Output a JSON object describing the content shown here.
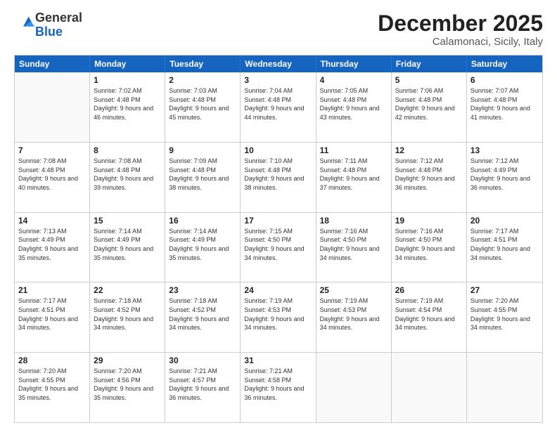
{
  "header": {
    "logo_general": "General",
    "logo_blue": "Blue",
    "month": "December 2025",
    "location": "Calamonaci, Sicily, Italy"
  },
  "days_of_week": [
    "Sunday",
    "Monday",
    "Tuesday",
    "Wednesday",
    "Thursday",
    "Friday",
    "Saturday"
  ],
  "weeks": [
    [
      {
        "day": "",
        "empty": true
      },
      {
        "day": "1",
        "sunrise": "Sunrise: 7:02 AM",
        "sunset": "Sunset: 4:48 PM",
        "daylight": "Daylight: 9 hours and 46 minutes."
      },
      {
        "day": "2",
        "sunrise": "Sunrise: 7:03 AM",
        "sunset": "Sunset: 4:48 PM",
        "daylight": "Daylight: 9 hours and 45 minutes."
      },
      {
        "day": "3",
        "sunrise": "Sunrise: 7:04 AM",
        "sunset": "Sunset: 4:48 PM",
        "daylight": "Daylight: 9 hours and 44 minutes."
      },
      {
        "day": "4",
        "sunrise": "Sunrise: 7:05 AM",
        "sunset": "Sunset: 4:48 PM",
        "daylight": "Daylight: 9 hours and 43 minutes."
      },
      {
        "day": "5",
        "sunrise": "Sunrise: 7:06 AM",
        "sunset": "Sunset: 4:48 PM",
        "daylight": "Daylight: 9 hours and 42 minutes."
      },
      {
        "day": "6",
        "sunrise": "Sunrise: 7:07 AM",
        "sunset": "Sunset: 4:48 PM",
        "daylight": "Daylight: 9 hours and 41 minutes."
      }
    ],
    [
      {
        "day": "7",
        "sunrise": "Sunrise: 7:08 AM",
        "sunset": "Sunset: 4:48 PM",
        "daylight": "Daylight: 9 hours and 40 minutes."
      },
      {
        "day": "8",
        "sunrise": "Sunrise: 7:08 AM",
        "sunset": "Sunset: 4:48 PM",
        "daylight": "Daylight: 9 hours and 39 minutes."
      },
      {
        "day": "9",
        "sunrise": "Sunrise: 7:09 AM",
        "sunset": "Sunset: 4:48 PM",
        "daylight": "Daylight: 9 hours and 38 minutes."
      },
      {
        "day": "10",
        "sunrise": "Sunrise: 7:10 AM",
        "sunset": "Sunset: 4:48 PM",
        "daylight": "Daylight: 9 hours and 38 minutes."
      },
      {
        "day": "11",
        "sunrise": "Sunrise: 7:11 AM",
        "sunset": "Sunset: 4:48 PM",
        "daylight": "Daylight: 9 hours and 37 minutes."
      },
      {
        "day": "12",
        "sunrise": "Sunrise: 7:12 AM",
        "sunset": "Sunset: 4:48 PM",
        "daylight": "Daylight: 9 hours and 36 minutes."
      },
      {
        "day": "13",
        "sunrise": "Sunrise: 7:12 AM",
        "sunset": "Sunset: 4:49 PM",
        "daylight": "Daylight: 9 hours and 36 minutes."
      }
    ],
    [
      {
        "day": "14",
        "sunrise": "Sunrise: 7:13 AM",
        "sunset": "Sunset: 4:49 PM",
        "daylight": "Daylight: 9 hours and 35 minutes."
      },
      {
        "day": "15",
        "sunrise": "Sunrise: 7:14 AM",
        "sunset": "Sunset: 4:49 PM",
        "daylight": "Daylight: 9 hours and 35 minutes."
      },
      {
        "day": "16",
        "sunrise": "Sunrise: 7:14 AM",
        "sunset": "Sunset: 4:49 PM",
        "daylight": "Daylight: 9 hours and 35 minutes."
      },
      {
        "day": "17",
        "sunrise": "Sunrise: 7:15 AM",
        "sunset": "Sunset: 4:50 PM",
        "daylight": "Daylight: 9 hours and 34 minutes."
      },
      {
        "day": "18",
        "sunrise": "Sunrise: 7:16 AM",
        "sunset": "Sunset: 4:50 PM",
        "daylight": "Daylight: 9 hours and 34 minutes."
      },
      {
        "day": "19",
        "sunrise": "Sunrise: 7:16 AM",
        "sunset": "Sunset: 4:50 PM",
        "daylight": "Daylight: 9 hours and 34 minutes."
      },
      {
        "day": "20",
        "sunrise": "Sunrise: 7:17 AM",
        "sunset": "Sunset: 4:51 PM",
        "daylight": "Daylight: 9 hours and 34 minutes."
      }
    ],
    [
      {
        "day": "21",
        "sunrise": "Sunrise: 7:17 AM",
        "sunset": "Sunset: 4:51 PM",
        "daylight": "Daylight: 9 hours and 34 minutes."
      },
      {
        "day": "22",
        "sunrise": "Sunrise: 7:18 AM",
        "sunset": "Sunset: 4:52 PM",
        "daylight": "Daylight: 9 hours and 34 minutes."
      },
      {
        "day": "23",
        "sunrise": "Sunrise: 7:18 AM",
        "sunset": "Sunset: 4:52 PM",
        "daylight": "Daylight: 9 hours and 34 minutes."
      },
      {
        "day": "24",
        "sunrise": "Sunrise: 7:19 AM",
        "sunset": "Sunset: 4:53 PM",
        "daylight": "Daylight: 9 hours and 34 minutes."
      },
      {
        "day": "25",
        "sunrise": "Sunrise: 7:19 AM",
        "sunset": "Sunset: 4:53 PM",
        "daylight": "Daylight: 9 hours and 34 minutes."
      },
      {
        "day": "26",
        "sunrise": "Sunrise: 7:19 AM",
        "sunset": "Sunset: 4:54 PM",
        "daylight": "Daylight: 9 hours and 34 minutes."
      },
      {
        "day": "27",
        "sunrise": "Sunrise: 7:20 AM",
        "sunset": "Sunset: 4:55 PM",
        "daylight": "Daylight: 9 hours and 34 minutes."
      }
    ],
    [
      {
        "day": "28",
        "sunrise": "Sunrise: 7:20 AM",
        "sunset": "Sunset: 4:55 PM",
        "daylight": "Daylight: 9 hours and 35 minutes."
      },
      {
        "day": "29",
        "sunrise": "Sunrise: 7:20 AM",
        "sunset": "Sunset: 4:56 PM",
        "daylight": "Daylight: 9 hours and 35 minutes."
      },
      {
        "day": "30",
        "sunrise": "Sunrise: 7:21 AM",
        "sunset": "Sunset: 4:57 PM",
        "daylight": "Daylight: 9 hours and 36 minutes."
      },
      {
        "day": "31",
        "sunrise": "Sunrise: 7:21 AM",
        "sunset": "Sunset: 4:58 PM",
        "daylight": "Daylight: 9 hours and 36 minutes."
      },
      {
        "day": "",
        "empty": true
      },
      {
        "day": "",
        "empty": true
      },
      {
        "day": "",
        "empty": true
      }
    ]
  ]
}
